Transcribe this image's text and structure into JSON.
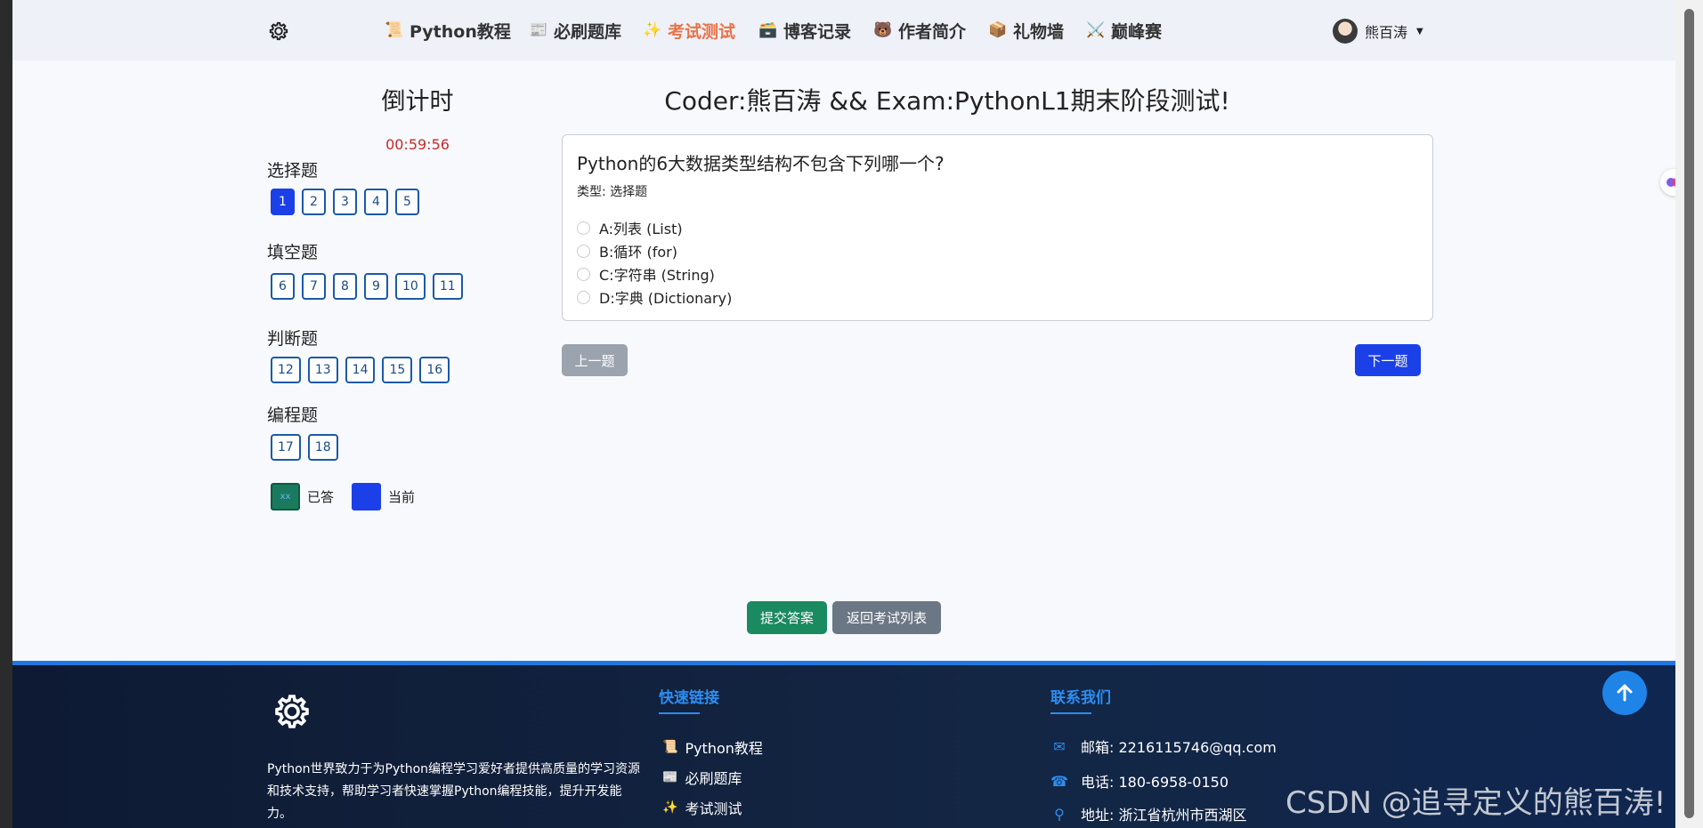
{
  "nav": {
    "items": [
      {
        "label": "Python教程",
        "icon": "📜"
      },
      {
        "label": "必刷题库",
        "icon": "📰"
      },
      {
        "label": "考试测试",
        "icon": "✨"
      },
      {
        "label": "博客记录",
        "icon": "🗃️"
      },
      {
        "label": "作者简介",
        "icon": "🐻"
      },
      {
        "label": "礼物墙",
        "icon": "📦"
      },
      {
        "label": "巅峰赛",
        "icon": "⚔️"
      }
    ],
    "active_index": 2,
    "active_color": "#e8734a",
    "user_name": "熊百涛"
  },
  "sidebar": {
    "countdown_title": "倒计时",
    "timer": "00:59:56",
    "sections": [
      {
        "title": "选择题",
        "questions": [
          "1",
          "2",
          "3",
          "4",
          "5"
        ]
      },
      {
        "title": "填空题",
        "questions": [
          "6",
          "7",
          "8",
          "9",
          "10",
          "11"
        ]
      },
      {
        "title": "判断题",
        "questions": [
          "12",
          "13",
          "14",
          "15",
          "16"
        ]
      },
      {
        "title": "编程题",
        "questions": [
          "17",
          "18"
        ]
      }
    ],
    "current_question": "1",
    "legend": {
      "answered_label": "已答",
      "answered_swatch_text": "xx",
      "current_label": "当前"
    }
  },
  "exam": {
    "title": "Coder:熊百涛 && Exam:PythonL1期末阶段测试!",
    "question": "Python的6大数据类型结构不包含下列哪一个?",
    "type_label": "类型: 选择题",
    "options": [
      "A:列表 (List)",
      "B:循环 (for)",
      "C:字符串 (String)",
      "D:字典 (Dictionary)"
    ],
    "prev_label": "上一题",
    "next_label": "下一题",
    "submit_label": "提交答案",
    "back_label": "返回考试列表"
  },
  "footer": {
    "description": "Python世界致力于为Python编程学习爱好者提供高质量的学习资源和技术支持，帮助学习者快速掌握Python编程技能，提升开发能力。",
    "quick_links_title": "快速链接",
    "quick_links": [
      {
        "label": "Python教程",
        "icon": "📜"
      },
      {
        "label": "必刷题库",
        "icon": "📰"
      },
      {
        "label": "考试测试",
        "icon": "✨"
      }
    ],
    "contact_title": "联系我们",
    "contact": [
      {
        "icon": "envelope-icon",
        "glyph": "✉",
        "text": "邮箱: 2216115746@qq.com"
      },
      {
        "icon": "phone-icon",
        "glyph": "☎",
        "text": "电话: 180-6958-0150"
      },
      {
        "icon": "location-icon",
        "glyph": "⚲",
        "text": "地址: 浙江省杭州市西湖区"
      }
    ],
    "accent_color": "#2e8df0"
  },
  "watermark": "CSDN @追寻定义的熊百涛!"
}
